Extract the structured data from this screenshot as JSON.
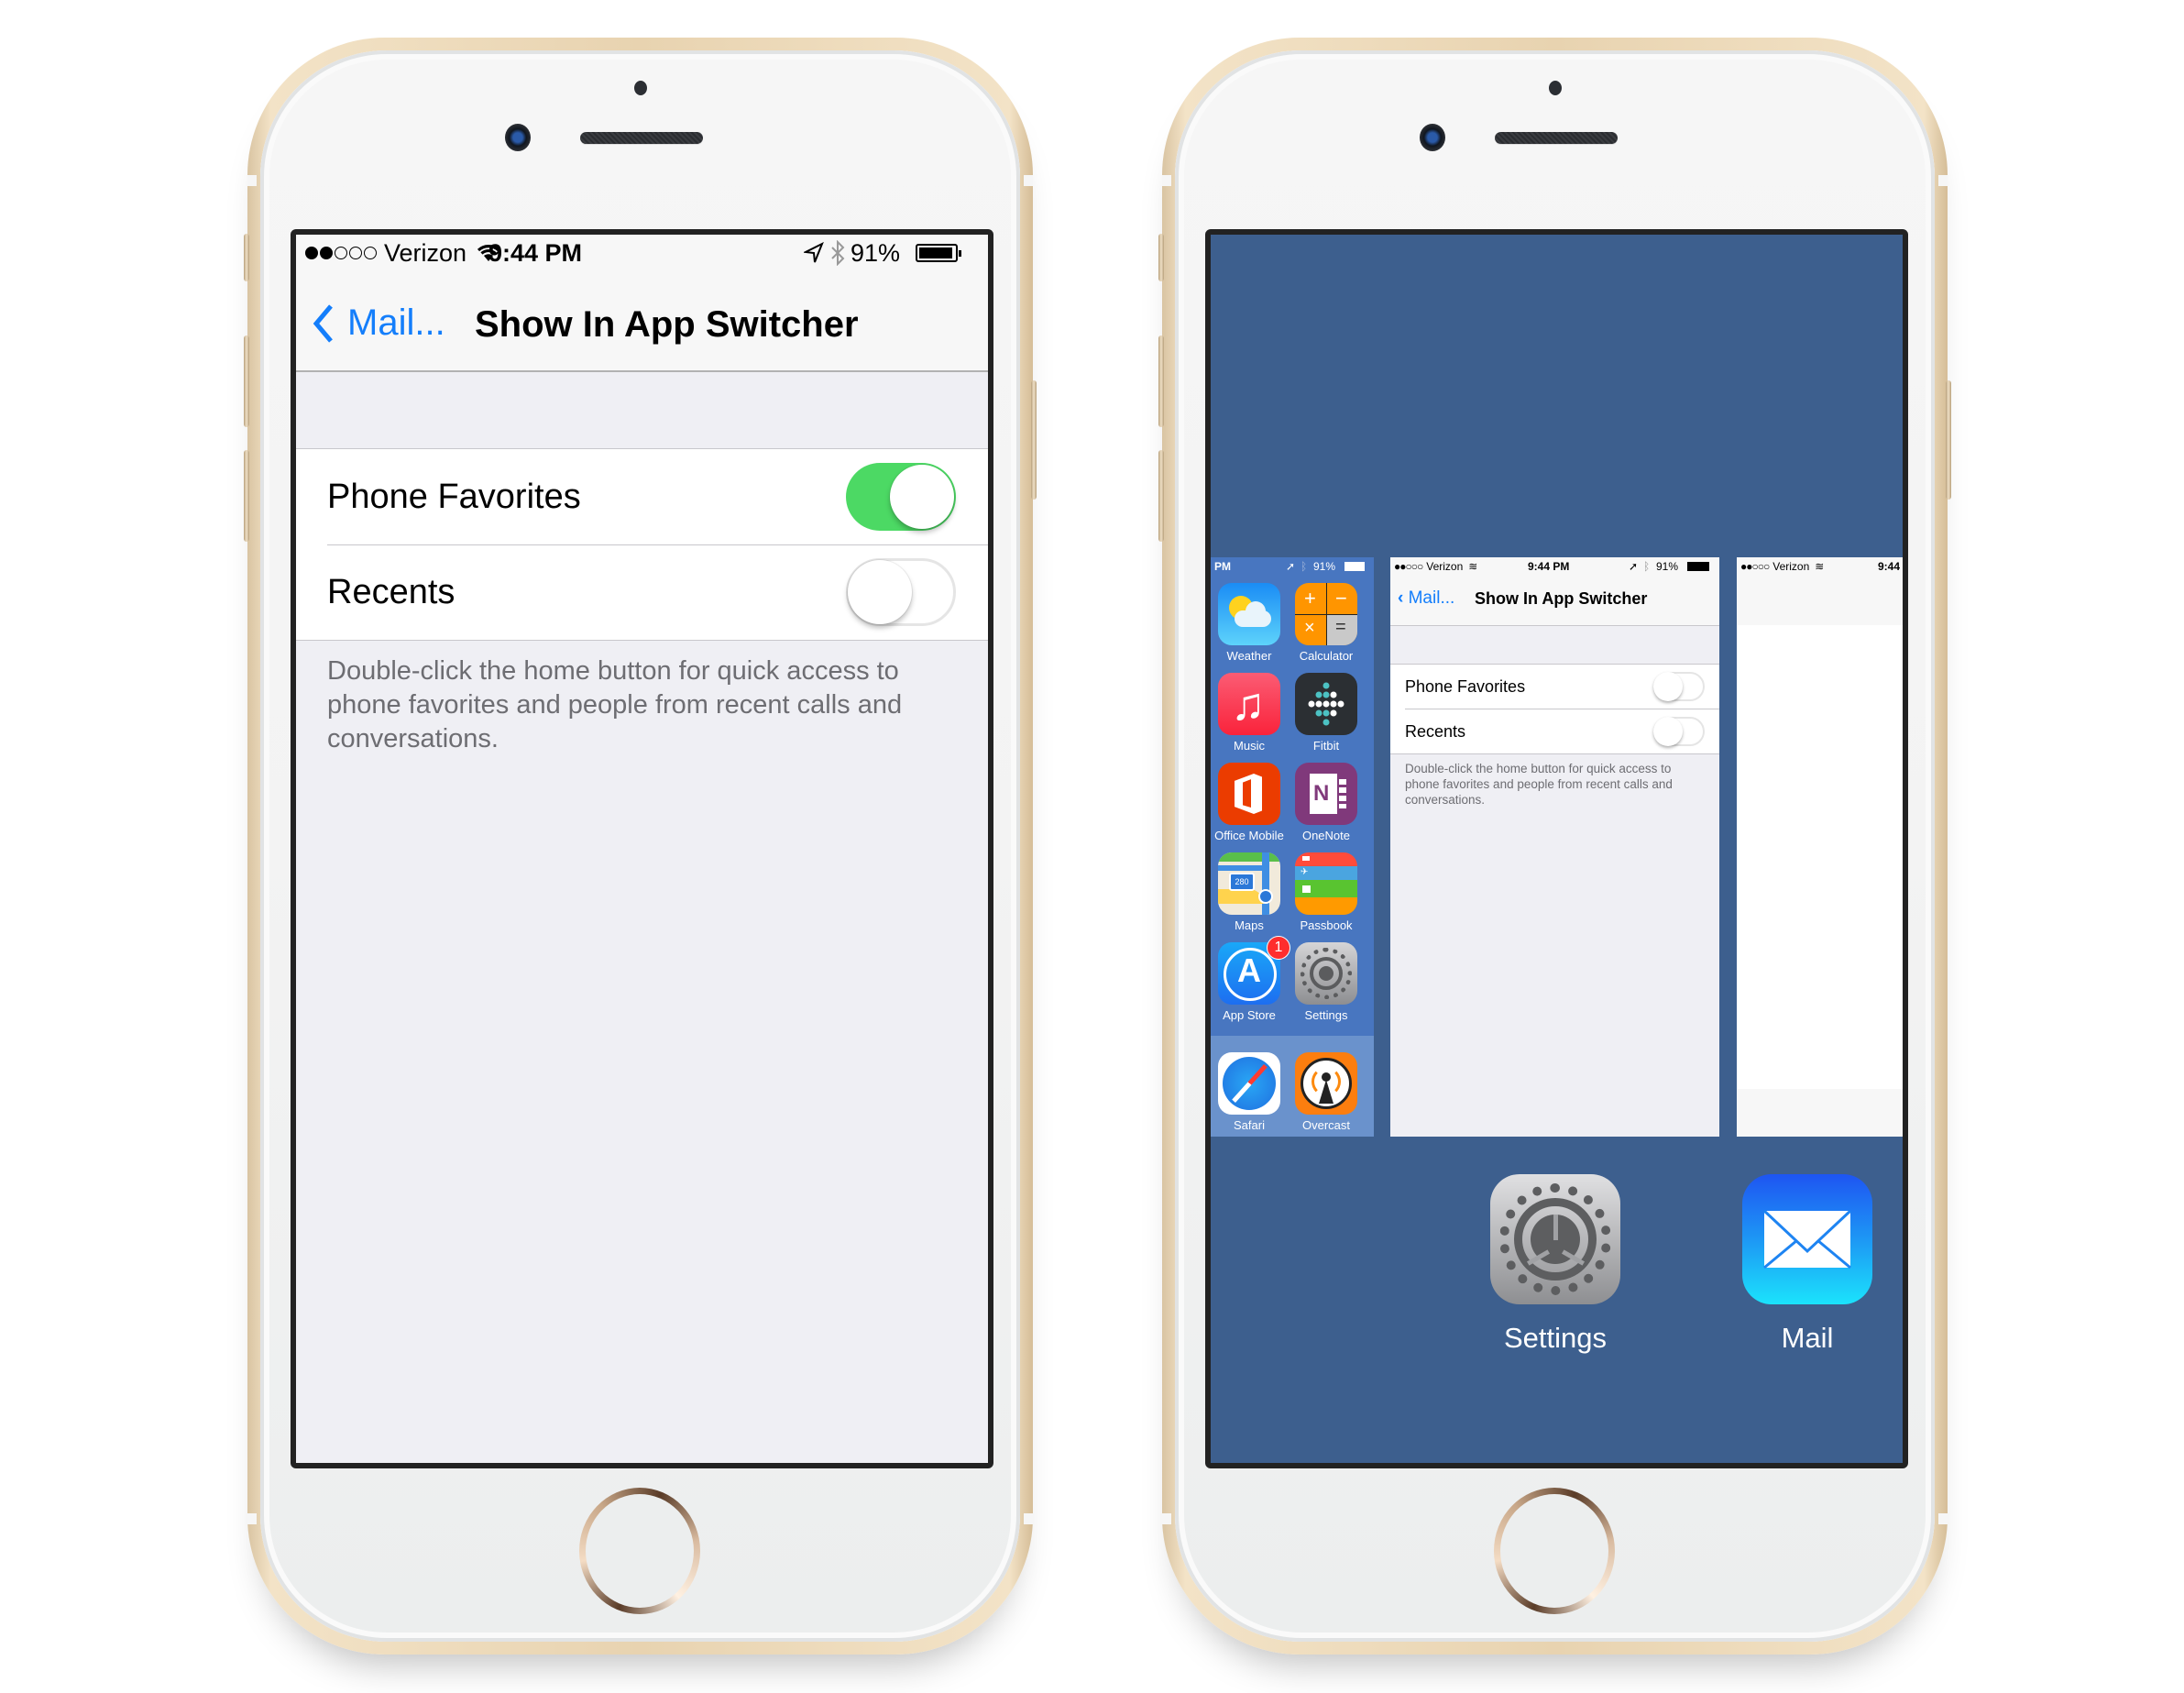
{
  "left_phone": {
    "status_bar": {
      "signal_bars_filled": 2,
      "signal_bars_total": 5,
      "carrier": "Verizon",
      "time": "9:44 PM",
      "battery": "91%",
      "icons": [
        "wifi-icon",
        "location-arrow-icon",
        "bluetooth-icon",
        "battery-icon"
      ]
    },
    "nav": {
      "back_label": "Mail...",
      "title": "Show In App Switcher"
    },
    "settings": [
      {
        "label": "Phone Favorites",
        "enabled": true
      },
      {
        "label": "Recents",
        "enabled": false
      }
    ],
    "footer": "Double-click the home button for quick access to phone favorites and people from recent calls and conversations.",
    "colors": {
      "accent": "#147EFB",
      "toggle_on": "#4CD964",
      "background": "#EFEFF4"
    }
  },
  "right_phone": {
    "background_color": "#3D5F8E",
    "home_card": {
      "status_time": "PM",
      "battery": "91%",
      "apps": [
        {
          "name": "Weather",
          "icon": "weather-icon"
        },
        {
          "name": "Calculator",
          "icon": "calculator-icon"
        },
        {
          "name": "Music",
          "icon": "music-icon"
        },
        {
          "name": "Fitbit",
          "icon": "fitbit-icon"
        },
        {
          "name": "Office Mobile",
          "icon": "office-icon"
        },
        {
          "name": "OneNote",
          "icon": "onenote-icon"
        },
        {
          "name": "Maps",
          "icon": "maps-icon",
          "map_shield": "280"
        },
        {
          "name": "Passbook",
          "icon": "passbook-icon"
        },
        {
          "name": "App Store",
          "icon": "app-store-icon",
          "badge": "1"
        },
        {
          "name": "Settings",
          "icon": "settings-icon"
        }
      ],
      "dock": [
        {
          "name": "Safari",
          "icon": "safari-icon"
        },
        {
          "name": "Overcast",
          "icon": "overcast-icon"
        }
      ]
    },
    "settings_card": {
      "carrier": "Verizon",
      "time": "9:44 PM",
      "battery": "91%",
      "back_label": "Mail...",
      "title": "Show In App Switcher",
      "rows": [
        {
          "label": "Phone Favorites",
          "enabled": false
        },
        {
          "label": "Recents",
          "enabled": false
        }
      ],
      "footer": "Double-click the home button for quick access to phone favorites and people from recent calls and conversations."
    },
    "mail_card": {
      "carrier": "Verizon",
      "time": "9:44"
    },
    "app_labels": {
      "settings": "Settings",
      "mail": "Mail"
    }
  }
}
